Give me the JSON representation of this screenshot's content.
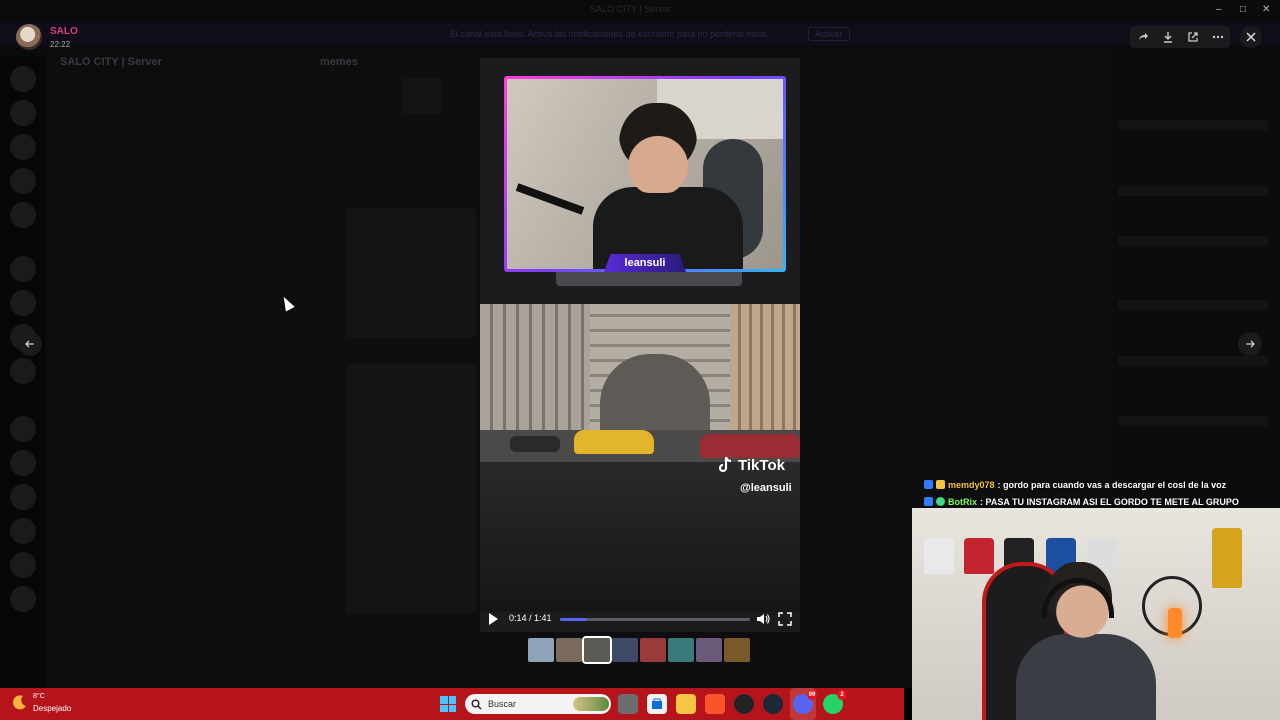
{
  "uploader": {
    "name": "SALO",
    "time": "22:22"
  },
  "background": {
    "window_title": "SALO CITY | Server",
    "server_name": "SALO CITY | Server",
    "channel_title": "memes",
    "banner_text": "El canal está lleno. Activa las notificaciones de escritorio para no perderte nada.",
    "banner_button": "Activar"
  },
  "viewer": {
    "toolbar": [
      "forward-icon",
      "download-icon",
      "open-external-icon",
      "more-icon"
    ],
    "close_icon": "close-icon",
    "prev_icon": "arrow-left-icon",
    "next_icon": "arrow-right-icon"
  },
  "video": {
    "streamer_nameplate": "leansuli",
    "tiktok_logo": "TikTok",
    "tiktok_handle": "@leansuli",
    "current_time": "0:14 / 1:41",
    "progress": 0.14,
    "thumbnail_count": 8
  },
  "stream_chat": [
    {
      "user": "memdy078",
      "user_color": "#f5c542",
      "message": ": gordo para cuando vas a descargar el cosl de la voz"
    },
    {
      "user": "BotRix",
      "user_color": "#7cff5a",
      "message": ": PASA TU INSTAGRAM ASI EL GORDO TE METE AL GRUPO"
    }
  ],
  "taskbar": {
    "weather_temp": "8°C",
    "weather_desc": "Despejado",
    "search_placeholder": "Buscar",
    "apps": [
      "file-explorer-icon",
      "folder-icon",
      "store-icon",
      "brave-icon",
      "obs-icon",
      "steam-icon",
      "discord-icon",
      "whatsapp-icon"
    ],
    "discord_badge": "99",
    "whatsapp_badge": "2"
  },
  "colors": {
    "taskbar": "#b5141b",
    "uploader_name": "#e03a8a",
    "accent": "#5865f2"
  }
}
